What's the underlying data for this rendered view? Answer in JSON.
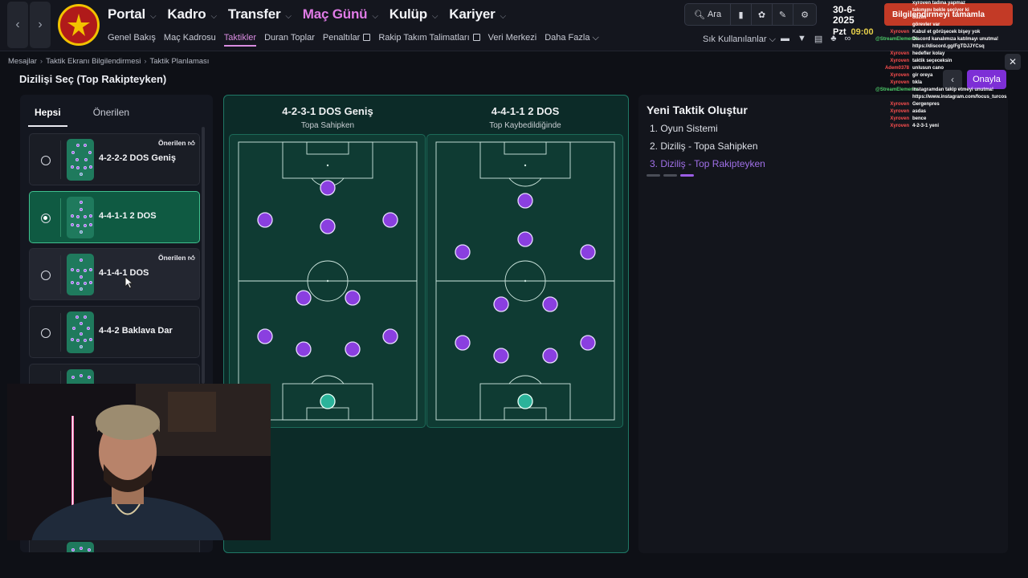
{
  "nav": {
    "back": "‹",
    "forward": "›",
    "main": [
      "Portal",
      "Kadro",
      "Transfer",
      "Maç Günü",
      "Kulüp",
      "Kariyer"
    ],
    "main_active": "Maç Günü",
    "sub": [
      "Genel Bakış",
      "Maç Kadrosu",
      "Taktikler",
      "Duran Toplar",
      "Penaltılar",
      "Rakip Takım Talimatları",
      "Veri Merkezi",
      "Daha Fazla"
    ],
    "sub_active": "Taktikler",
    "search_label": "Ara",
    "date": "30-6-2025",
    "weekday": "Pzt",
    "time": "09:00",
    "notification": "Bilgilendirmeyi tamamla",
    "quick_label": "Sık Kullanılanlar"
  },
  "breadcrumb": [
    "Mesajlar",
    "Taktik Ekranı Bilgilendirmesi",
    "Taktik Planlaması"
  ],
  "page": {
    "title": "Dizilişi Seç (Top Rakipteyken)",
    "confirm": "Onayla",
    "back": "‹",
    "close": "✕"
  },
  "tabs": [
    "Hepsi",
    "Önerilen"
  ],
  "recommended_badge": "Önerilen",
  "formations": [
    {
      "name": "4-2-2-2 DOS Geniş",
      "recommended": true,
      "selected": false
    },
    {
      "name": "4-4-1-1 2 DOS",
      "recommended": false,
      "selected": true
    },
    {
      "name": "4-1-4-1 DOS",
      "recommended": true,
      "selected": false
    },
    {
      "name": "4-4-2 Baklava Dar",
      "recommended": false,
      "selected": false
    }
  ],
  "pitches": [
    {
      "title": "4-2-3-1 DOS Geniş",
      "subtitle": "Topa Sahipken"
    },
    {
      "title": "4-4-1-1 2 DOS",
      "subtitle": "Top Kaybedildiğinde"
    }
  ],
  "wizard": {
    "title": "Yeni Taktik Oluştur",
    "steps": [
      "1. Oyun Sistemi",
      "2. Diziliş - Topa Sahipken",
      "3. Diziliş - Top Rakipteyken"
    ],
    "active_step": 3
  },
  "chat": [
    {
      "user": "",
      "text": "xyroven tadına yapmaz"
    },
    {
      "user": "",
      "text": "takımımı bekle seçiyor ki"
    },
    {
      "user": "",
      "text": "düzim"
    },
    {
      "user": "",
      "text": "görevler var"
    },
    {
      "user": "Xyroven",
      "text": "Kabul et görüşecek bişey yok"
    },
    {
      "user": "@StreamElements",
      "text": "Discord kanalımıza katılmayı unutma!"
    },
    {
      "user": "",
      "text": "https://discord.gg/FgTDJJYCsq"
    },
    {
      "user": "Xyroven",
      "text": "hedefler kolay"
    },
    {
      "user": "Xyroven",
      "text": "taktik seçeceksin"
    },
    {
      "user": "Adem0378",
      "text": "unlusun cano"
    },
    {
      "user": "Xyroven",
      "text": "gir oreya"
    },
    {
      "user": "Xyroven",
      "text": "tıkla"
    },
    {
      "user": "@StreamElements",
      "text": "instagramdan takip etmeyi unutma!"
    },
    {
      "user": "",
      "text": "https://www.instagram.com/focus_turcos"
    },
    {
      "user": "Xyroven",
      "text": "Gergenpres"
    },
    {
      "user": "Xyroven",
      "text": "asdas"
    },
    {
      "user": "Xyroven",
      "text": "bence"
    },
    {
      "user": "Xyroven",
      "text": "4-2-3-1 yeni"
    }
  ],
  "colors": {
    "accent": "#7d2fd6",
    "active_nav": "#e07be6",
    "player": "#8a3fe0",
    "goalkeeper": "#2bb39a",
    "pitch": "#0f3b33",
    "selected_card": "#0f5a42"
  }
}
